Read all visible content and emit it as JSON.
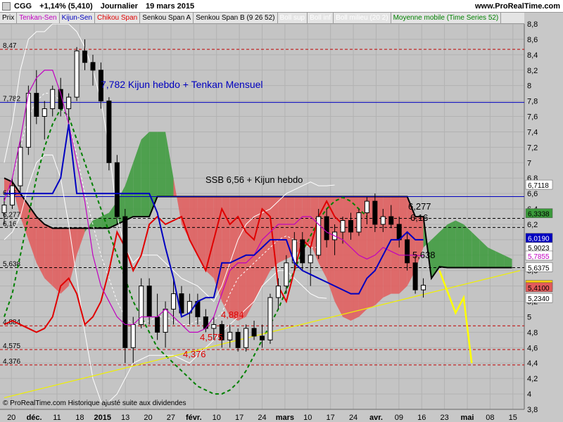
{
  "header": {
    "symbol": "CGG",
    "change": "+1,14% (5,410)",
    "period": "Journalier",
    "date": "19 mars 2015",
    "site": "www.ProRealTime.com"
  },
  "legend": [
    {
      "label": "Prix",
      "color": "#000000"
    },
    {
      "label": "Tenkan-Sen",
      "color": "#c000c0"
    },
    {
      "label": "Kijun-Sen",
      "color": "#0000c0"
    },
    {
      "label": "Chikou Span",
      "color": "#e00000"
    },
    {
      "label": "Senkou Span A",
      "color": "#000000"
    },
    {
      "label": "Senkou Span B (9 26 52)",
      "color": "#000000"
    },
    {
      "label": "Boll sup",
      "color": "#ffffff"
    },
    {
      "label": "Boll inf",
      "color": "#ffffff"
    },
    {
      "label": "Boll milieu (20 2)",
      "color": "#ffffff"
    },
    {
      "label": "Moyenne mobile (Time Series 52)",
      "color": "#008000"
    }
  ],
  "footer": "© ProRealTime.com Historique ajusté suite aux dividendes",
  "colors": {
    "bg": "#c8c8c8",
    "cloud_bull": "#3a9a3a",
    "cloud_bear": "#e35a5a",
    "kijun": "#0000c0",
    "tenkan": "#c000c0",
    "chikou": "#e00000",
    "trend": "#f0f000",
    "ma": "#008000"
  },
  "chart_data": {
    "type": "candlestick",
    "ylim": [
      3.8,
      8.8
    ],
    "yticks": [
      "3,8",
      "4",
      "4,2",
      "4,4",
      "4,6",
      "4,8",
      "5",
      "5,2",
      "5,4",
      "5,6",
      "5,8",
      "6",
      "6,2",
      "6,4",
      "6,6",
      "6,8",
      "7",
      "7,2",
      "7,4",
      "7,6",
      "7,8",
      "8",
      "8,2",
      "8,4",
      "8,6",
      "8,8"
    ],
    "xticks": [
      "20",
      "déc.",
      "11",
      "18",
      "2015",
      "13",
      "20",
      "27",
      "févr.",
      "10",
      "17",
      "24",
      "mars",
      "10",
      "17",
      "24",
      "avr.",
      "09",
      "16",
      "23",
      "mai",
      "08",
      "15"
    ],
    "hlines": [
      {
        "y": 8.47,
        "label": "8,47",
        "color": "#c00000",
        "style": "dash"
      },
      {
        "y": 7.782,
        "label": "7,782",
        "color": "#0000c0",
        "style": "solid"
      },
      {
        "y": 6.56,
        "label": "6,56",
        "color": "#0000c0",
        "style": "solid"
      },
      {
        "y": 6.277,
        "label": "6,277",
        "color": "#000000",
        "style": "dash"
      },
      {
        "y": 6.16,
        "label": "6,16",
        "color": "#000000",
        "style": "dash"
      },
      {
        "y": 5.638,
        "label": "5,638",
        "color": "#000000",
        "style": "dash"
      },
      {
        "y": 4.884,
        "label": "4,884",
        "color": "#c00000",
        "style": "dash"
      },
      {
        "y": 4.575,
        "label": "4,575",
        "color": "#c00000",
        "style": "dash"
      },
      {
        "y": 4.376,
        "label": "4,376",
        "color": "#c00000",
        "style": "dash"
      }
    ],
    "annotations": [
      {
        "text": "7,782 Kijun hebdo + Tenkan Mensuel",
        "color": "#0000c0"
      },
      {
        "text": "SSB 6,56 + Kijun hebdo",
        "color": "#000000"
      },
      {
        "text": "6,277",
        "color": "#000000"
      },
      {
        "text": "6,16",
        "color": "#000000"
      },
      {
        "text": "5,638",
        "color": "#000000"
      },
      {
        "text": "4,884",
        "color": "#e00000"
      },
      {
        "text": "4,575",
        "color": "#e00000"
      },
      {
        "text": "4,376",
        "color": "#e00000"
      }
    ],
    "price_tags": [
      {
        "text": "6,7118",
        "bg": "#ffffff",
        "fg": "#000000"
      },
      {
        "text": "6,3338",
        "bg": "#3a9a3a",
        "fg": "#000000"
      },
      {
        "text": "6,0190",
        "bg": "#0000c0",
        "fg": "#ffffff"
      },
      {
        "text": "5,9023",
        "bg": "#ffffff",
        "fg": "#000000"
      },
      {
        "text": "5,7855",
        "bg": "#ffffff",
        "fg": "#c000c0"
      },
      {
        "text": "5,6375",
        "bg": "#ffffff",
        "fg": "#000000"
      },
      {
        "text": "5,410",
        "bg": "#ffd000",
        "fg": "#000000"
      },
      {
        "text": "5,4100",
        "bg": "#e35a5a",
        "fg": "#000000"
      },
      {
        "text": "5,2340",
        "bg": "#ffffff",
        "fg": "#000000"
      }
    ],
    "candles": [
      [
        6.35,
        6.55,
        6.2,
        6.45
      ],
      [
        6.45,
        6.8,
        6.4,
        6.7
      ],
      [
        6.7,
        7.3,
        6.6,
        7.2
      ],
      [
        7.2,
        8.0,
        7.1,
        7.9
      ],
      [
        7.9,
        8.2,
        7.5,
        7.6
      ],
      [
        7.6,
        7.8,
        7.3,
        7.7
      ],
      [
        7.7,
        8.0,
        7.6,
        7.95
      ],
      [
        7.95,
        8.1,
        7.6,
        7.7
      ],
      [
        7.7,
        7.9,
        7.5,
        7.85
      ],
      [
        7.85,
        8.5,
        7.8,
        8.45
      ],
      [
        8.45,
        8.6,
        8.2,
        8.3
      ],
      [
        8.3,
        8.4,
        8.0,
        8.2
      ],
      [
        8.2,
        8.3,
        7.7,
        7.8
      ],
      [
        7.8,
        7.85,
        6.9,
        7.0
      ],
      [
        7.0,
        7.1,
        6.2,
        6.3
      ],
      [
        6.3,
        6.4,
        4.4,
        4.6
      ],
      [
        4.6,
        5.0,
        4.4,
        4.9
      ],
      [
        4.9,
        5.5,
        4.85,
        5.4
      ],
      [
        5.4,
        5.5,
        4.9,
        5.0
      ],
      [
        5.0,
        5.3,
        4.7,
        4.8
      ],
      [
        4.8,
        5.2,
        4.6,
        5.1
      ],
      [
        5.1,
        5.5,
        4.9,
        5.3
      ],
      [
        5.3,
        5.4,
        5.0,
        5.05
      ],
      [
        5.05,
        5.3,
        4.9,
        5.2
      ],
      [
        5.2,
        5.3,
        4.9,
        5.0
      ],
      [
        5.0,
        5.1,
        4.8,
        4.85
      ],
      [
        4.85,
        5.0,
        4.7,
        4.9
      ],
      [
        4.9,
        4.95,
        4.6,
        4.7
      ],
      [
        4.7,
        4.9,
        4.6,
        4.8
      ],
      [
        4.8,
        4.85,
        4.55,
        4.6
      ],
      [
        4.6,
        4.9,
        4.55,
        4.85
      ],
      [
        4.85,
        4.95,
        4.7,
        4.75
      ],
      [
        4.75,
        4.9,
        4.6,
        4.7
      ],
      [
        4.7,
        5.3,
        4.65,
        5.25
      ],
      [
        5.25,
        5.5,
        5.1,
        5.4
      ],
      [
        5.4,
        5.8,
        5.3,
        5.7
      ],
      [
        5.7,
        6.1,
        5.6,
        6.0
      ],
      [
        6.0,
        6.1,
        5.6,
        5.7
      ],
      [
        5.7,
        5.9,
        5.4,
        5.8
      ],
      [
        5.8,
        6.4,
        5.75,
        6.3
      ],
      [
        6.3,
        6.4,
        5.9,
        6.0
      ],
      [
        6.0,
        6.2,
        5.8,
        6.1
      ],
      [
        6.1,
        6.3,
        5.95,
        6.25
      ],
      [
        6.25,
        6.35,
        6.0,
        6.1
      ],
      [
        6.1,
        6.4,
        6.05,
        6.35
      ],
      [
        6.35,
        6.55,
        6.2,
        6.5
      ],
      [
        6.5,
        6.6,
        6.1,
        6.2
      ],
      [
        6.2,
        6.4,
        6.1,
        6.3
      ],
      [
        6.3,
        6.45,
        6.15,
        6.2
      ],
      [
        6.2,
        6.3,
        5.9,
        6.0
      ],
      [
        6.0,
        6.1,
        5.6,
        5.7
      ],
      [
        5.7,
        5.8,
        5.3,
        5.35
      ],
      [
        5.35,
        5.5,
        5.25,
        5.41
      ]
    ],
    "kijun": [
      6.6,
      6.6,
      6.6,
      6.6,
      6.6,
      6.6,
      6.6,
      6.8,
      7.5,
      6.6,
      6.6,
      6.6,
      6.6,
      6.6,
      6.6,
      6.6,
      6.6,
      6.6,
      6.6,
      6.35,
      5.9,
      5.5,
      5.0,
      5.05,
      5.2,
      5.25,
      5.25,
      5.7,
      5.7,
      5.75,
      5.8,
      5.8,
      5.9,
      6.0,
      6.0,
      6.0,
      5.7,
      5.6,
      5.55,
      5.5,
      5.45,
      5.4,
      5.35,
      5.3,
      5.3,
      5.5,
      5.6,
      5.8,
      6.0,
      6.0,
      6.1,
      6.0,
      6.0
    ],
    "tenkan": [
      6.5,
      6.8,
      7.3,
      7.9,
      8.1,
      8.2,
      8.2,
      7.9,
      7.5,
      7.0,
      6.5,
      5.8,
      5.4,
      5.2,
      5.0,
      4.9,
      4.9,
      5.0,
      5.0,
      5.0,
      5.1,
      5.0,
      4.9,
      4.8,
      4.8,
      4.85,
      5.0,
      5.3,
      5.6,
      5.7,
      5.7,
      5.8,
      6.0,
      6.1,
      6.2,
      6.2,
      6.2,
      6.3,
      6.3,
      6.2,
      6.1,
      6.05,
      6.0,
      5.9,
      5.8,
      5.75,
      5.8,
      5.9,
      5.85,
      5.8,
      5.8,
      5.8,
      5.79
    ],
    "chikou": [
      4.9,
      4.95,
      4.9,
      4.85,
      4.8,
      4.85,
      5.0,
      5.4,
      5.5,
      5.3,
      4.9,
      5.0,
      5.2,
      5.6,
      6.1,
      5.9,
      5.6,
      5.8,
      6.2,
      6.3,
      6.2,
      6.25,
      6.3,
      6.0,
      5.8,
      5.6,
      6.0,
      6.4,
      6.2,
      6.3,
      6.1,
      6.0,
      6.4,
      6.3,
      5.4,
      5.2,
      5.6,
      6.0,
      5.9,
      6.3,
      6.5,
      6.3,
      6.2
    ],
    "ssb": [
      6.8,
      6.75,
      6.6,
      6.45,
      6.3,
      6.2,
      6.15,
      6.15,
      6.15,
      6.15,
      6.15,
      6.15,
      6.15,
      6.15,
      6.2,
      6.25,
      6.3,
      6.3,
      6.3,
      6.56,
      6.56,
      6.56,
      6.56,
      6.56,
      6.56,
      6.56,
      6.56,
      6.56,
      6.56,
      6.56,
      6.56,
      6.56,
      6.56,
      6.56,
      6.56,
      6.56,
      6.56,
      6.56,
      6.56,
      6.56,
      6.56,
      6.56,
      6.56,
      6.56,
      6.56,
      6.56,
      6.56,
      6.56,
      6.56,
      6.56,
      6.56,
      6.3,
      6.3,
      5.5,
      5.65,
      5.638,
      5.638,
      5.638,
      5.638,
      5.638,
      5.638,
      5.638,
      5.638,
      5.638
    ],
    "ssa": [
      6.6,
      6.7,
      6.3,
      6.0,
      5.7,
      5.5,
      5.4,
      5.3,
      5.4,
      5.8,
      6.1,
      6.25,
      6.3,
      6.35,
      6.5,
      6.7,
      7.0,
      7.3,
      7.4,
      7.4,
      7.4,
      6.8,
      6.2,
      6.0,
      5.8,
      5.6,
      5.5,
      5.2,
      5.0,
      4.95,
      5.0,
      5.2,
      5.4,
      5.6,
      5.7,
      5.75,
      5.8,
      5.9,
      5.95,
      5.7,
      5.5,
      5.2,
      5.0,
      4.95,
      5.0,
      5.1,
      5.15,
      5.25,
      5.3,
      5.3,
      5.4,
      5.6,
      5.9,
      6.0,
      6.1,
      6.2,
      6.25,
      6.2,
      6.1,
      6.0,
      5.9,
      5.85,
      5.8,
      5.75
    ],
    "ma52": [
      5.0,
      5.3,
      5.8,
      6.3,
      6.8,
      7.2,
      7.5,
      7.7,
      7.6,
      7.3,
      7.0,
      6.7,
      6.4,
      6.1,
      5.8,
      5.5,
      5.2,
      5.0,
      4.8,
      4.6,
      4.5,
      4.4,
      4.3,
      4.2,
      4.1,
      4.05,
      4.0,
      4.0,
      4.05,
      4.15,
      4.3,
      4.5,
      4.7,
      4.9,
      5.1,
      5.35,
      5.6,
      5.85,
      6.05,
      6.25,
      6.4,
      6.5,
      6.55,
      6.5,
      6.4,
      6.3
    ],
    "boll_sup": [
      7.0,
      7.5,
      8.2,
      8.6,
      8.7,
      8.7,
      8.8,
      8.8,
      8.8,
      8.7,
      8.5,
      8.2,
      7.8,
      7.2,
      6.3,
      5.9,
      5.7,
      5.8,
      5.8,
      5.8,
      5.7,
      5.6,
      5.5,
      5.45,
      5.4,
      5.3,
      5.2,
      5.4,
      5.7,
      6.0,
      6.2,
      6.3,
      6.35,
      6.4,
      6.5,
      6.6,
      6.65,
      6.7,
      6.75,
      6.7,
      6.7,
      6.71
    ],
    "boll_inf": [
      6.0,
      6.1,
      6.3,
      6.7,
      7.0,
      7.1,
      7.1,
      6.8,
      6.2,
      5.5,
      4.8,
      4.2,
      3.9,
      3.9,
      4.0,
      4.2,
      4.4,
      4.45,
      4.5,
      4.5,
      4.5,
      4.5,
      4.45,
      4.4,
      4.5,
      4.6,
      4.7,
      4.8,
      4.9,
      5.0,
      5.1,
      5.2,
      5.4,
      5.5,
      5.6,
      5.6,
      5.5,
      5.4,
      5.3,
      5.25,
      5.24
    ],
    "boll_mid": [
      6.5,
      6.8,
      7.2,
      7.6,
      7.8,
      7.9,
      7.9,
      7.8,
      7.5,
      7.1,
      6.6,
      6.2,
      5.8,
      5.5,
      5.2,
      5.0,
      4.9,
      4.9,
      4.95,
      5.0,
      5.0,
      4.95,
      4.9,
      4.9,
      4.95,
      4.95,
      4.95,
      5.05,
      5.3,
      5.5,
      5.6,
      5.7,
      5.8,
      5.9,
      6.0,
      6.05,
      6.0,
      5.95,
      5.9,
      5.9
    ],
    "trendline": {
      "from": [
        0,
        3.95
      ],
      "to": [
        64,
        5.6
      ]
    },
    "projection_arrow": [
      [
        54,
        5.6
      ],
      [
        56,
        5.05
      ],
      [
        57,
        5.25
      ],
      [
        58,
        4.4
      ]
    ]
  }
}
